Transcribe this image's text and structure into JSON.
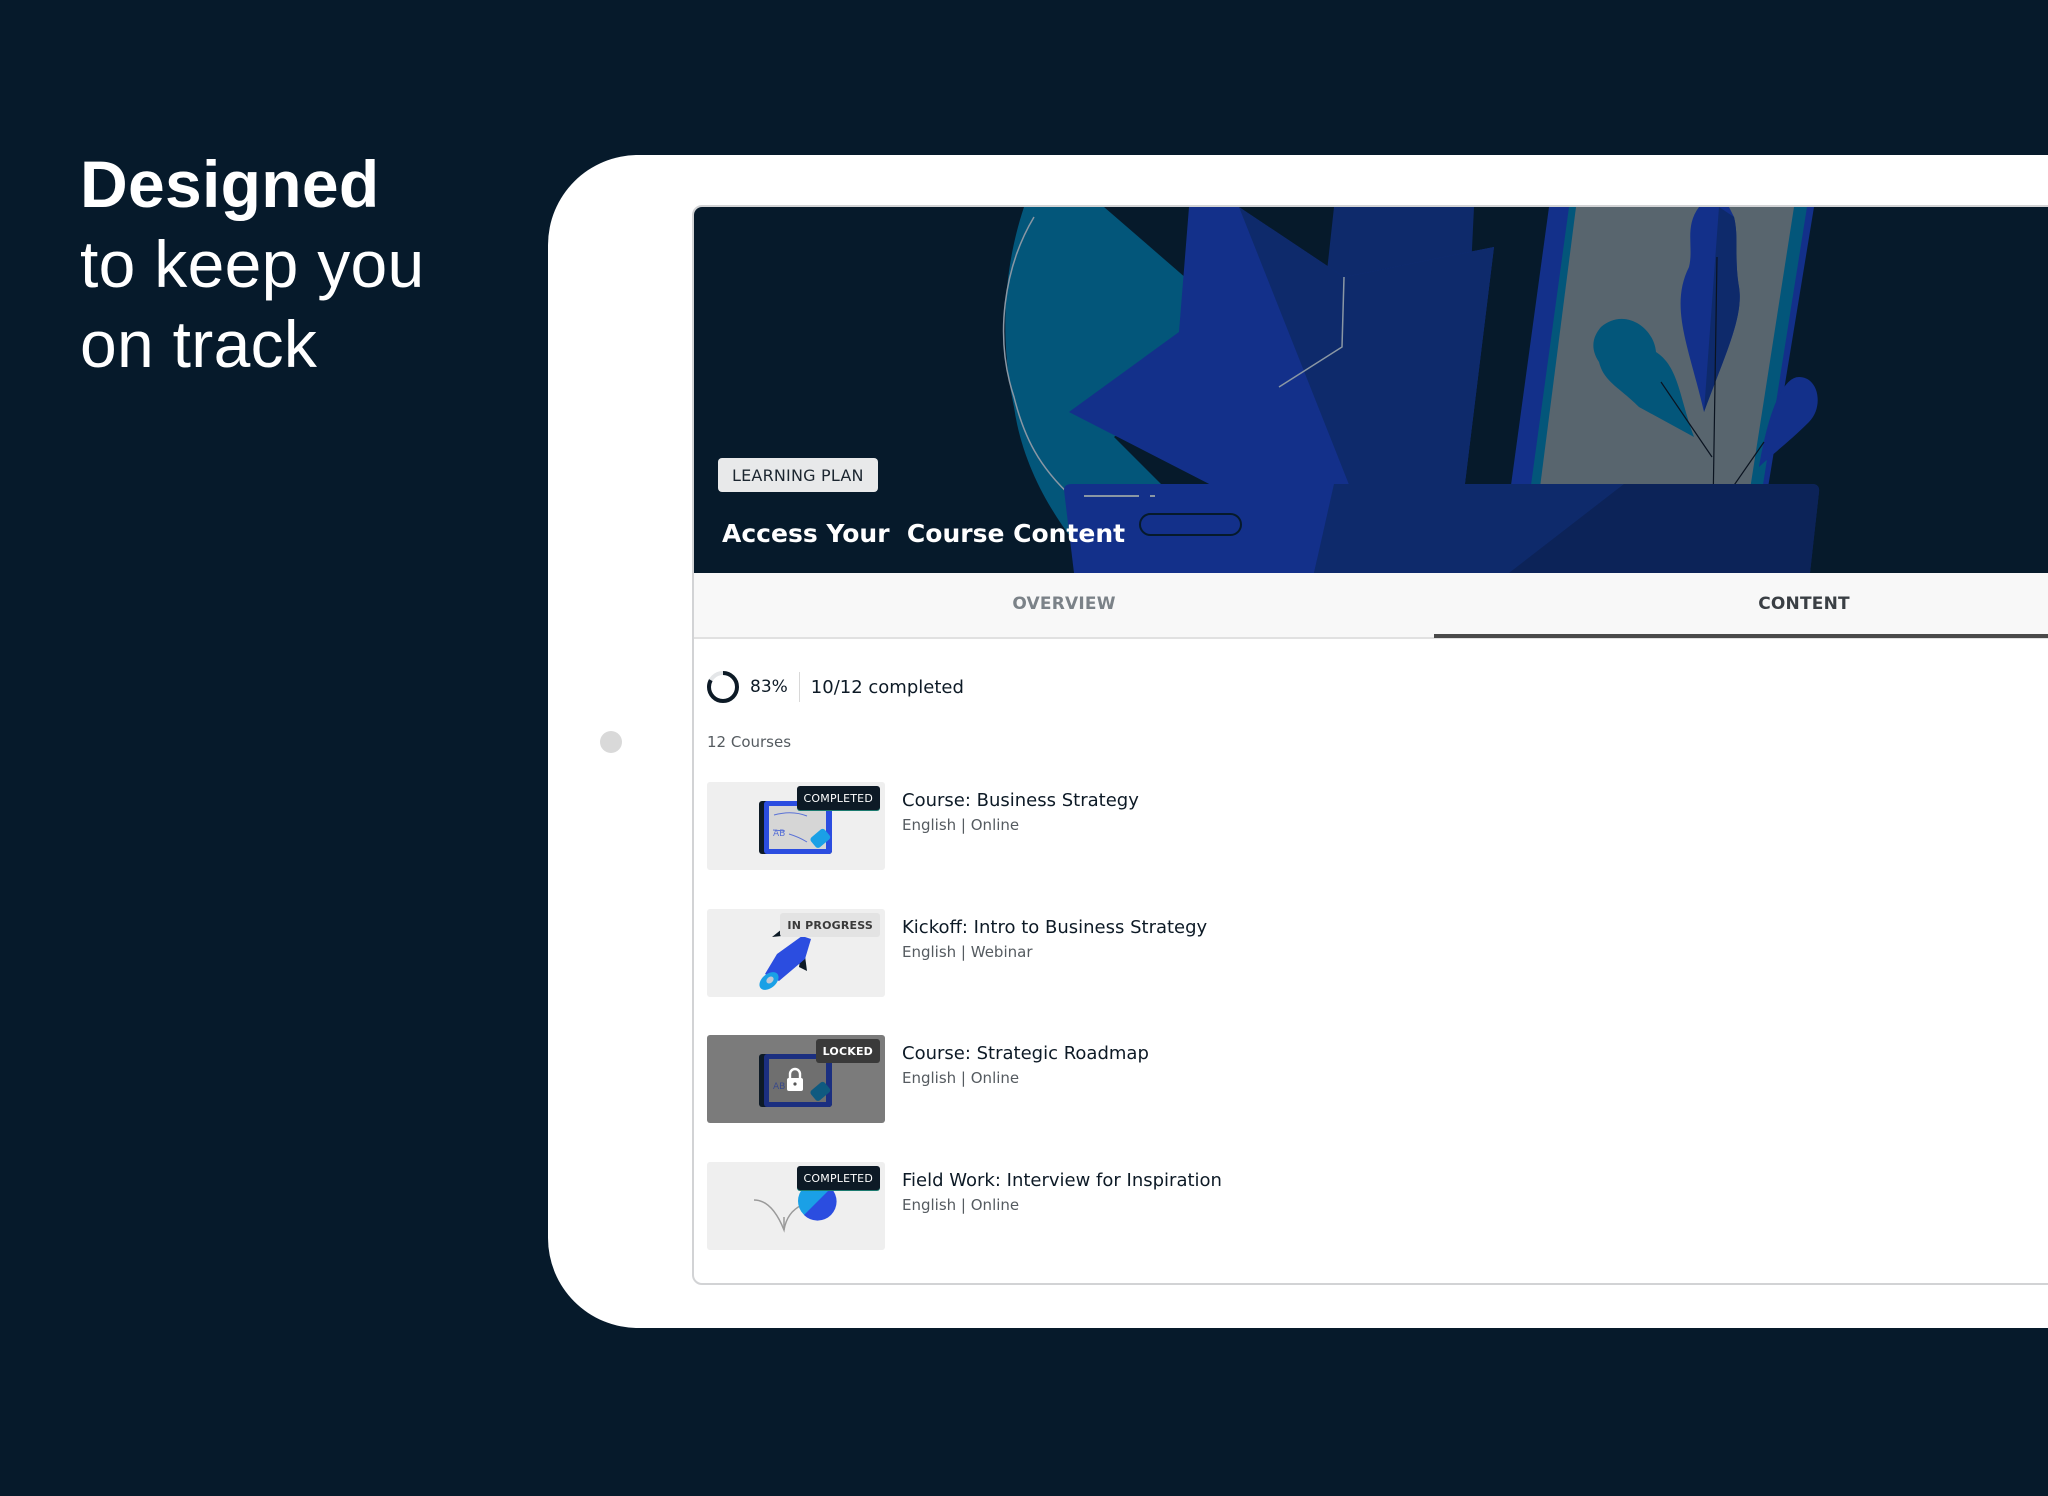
{
  "headline": {
    "line1": "Designed",
    "line2": "to keep you",
    "line3": "on track"
  },
  "banner": {
    "badge": "LEARNING PLAN",
    "title": "Access Your  Course Content"
  },
  "tabs": [
    {
      "label": "OVERVIEW",
      "active": false
    },
    {
      "label": "CONTENT",
      "active": true
    }
  ],
  "progress": {
    "percent_label": "83%",
    "percent_value": 83,
    "completed_label": "10/12 completed",
    "completed": 10,
    "total": 12
  },
  "course_count": "12 Courses",
  "courses": [
    {
      "title": "Course: Business Strategy",
      "meta": "English | Online",
      "status": "COMPLETED",
      "thumbnail": "tablet-whiteboard"
    },
    {
      "title": "Kickoff: Intro to Business Strategy",
      "meta": "English | Webinar",
      "status": "IN PROGRESS",
      "thumbnail": "rocket"
    },
    {
      "title": "Course: Strategic Roadmap",
      "meta": "English | Online",
      "status": "LOCKED",
      "thumbnail": "tablet-whiteboard-locked"
    },
    {
      "title": "Field Work: Interview for Inspiration",
      "meta": "English | Online",
      "status": "COMPLETED",
      "thumbnail": "ball-bounce"
    }
  ],
  "colors": {
    "background": "#061a2b",
    "active_tab_underline": "#4a4a4a",
    "completed_badge": "#0d1a26",
    "accent_blue": "#13308a"
  }
}
